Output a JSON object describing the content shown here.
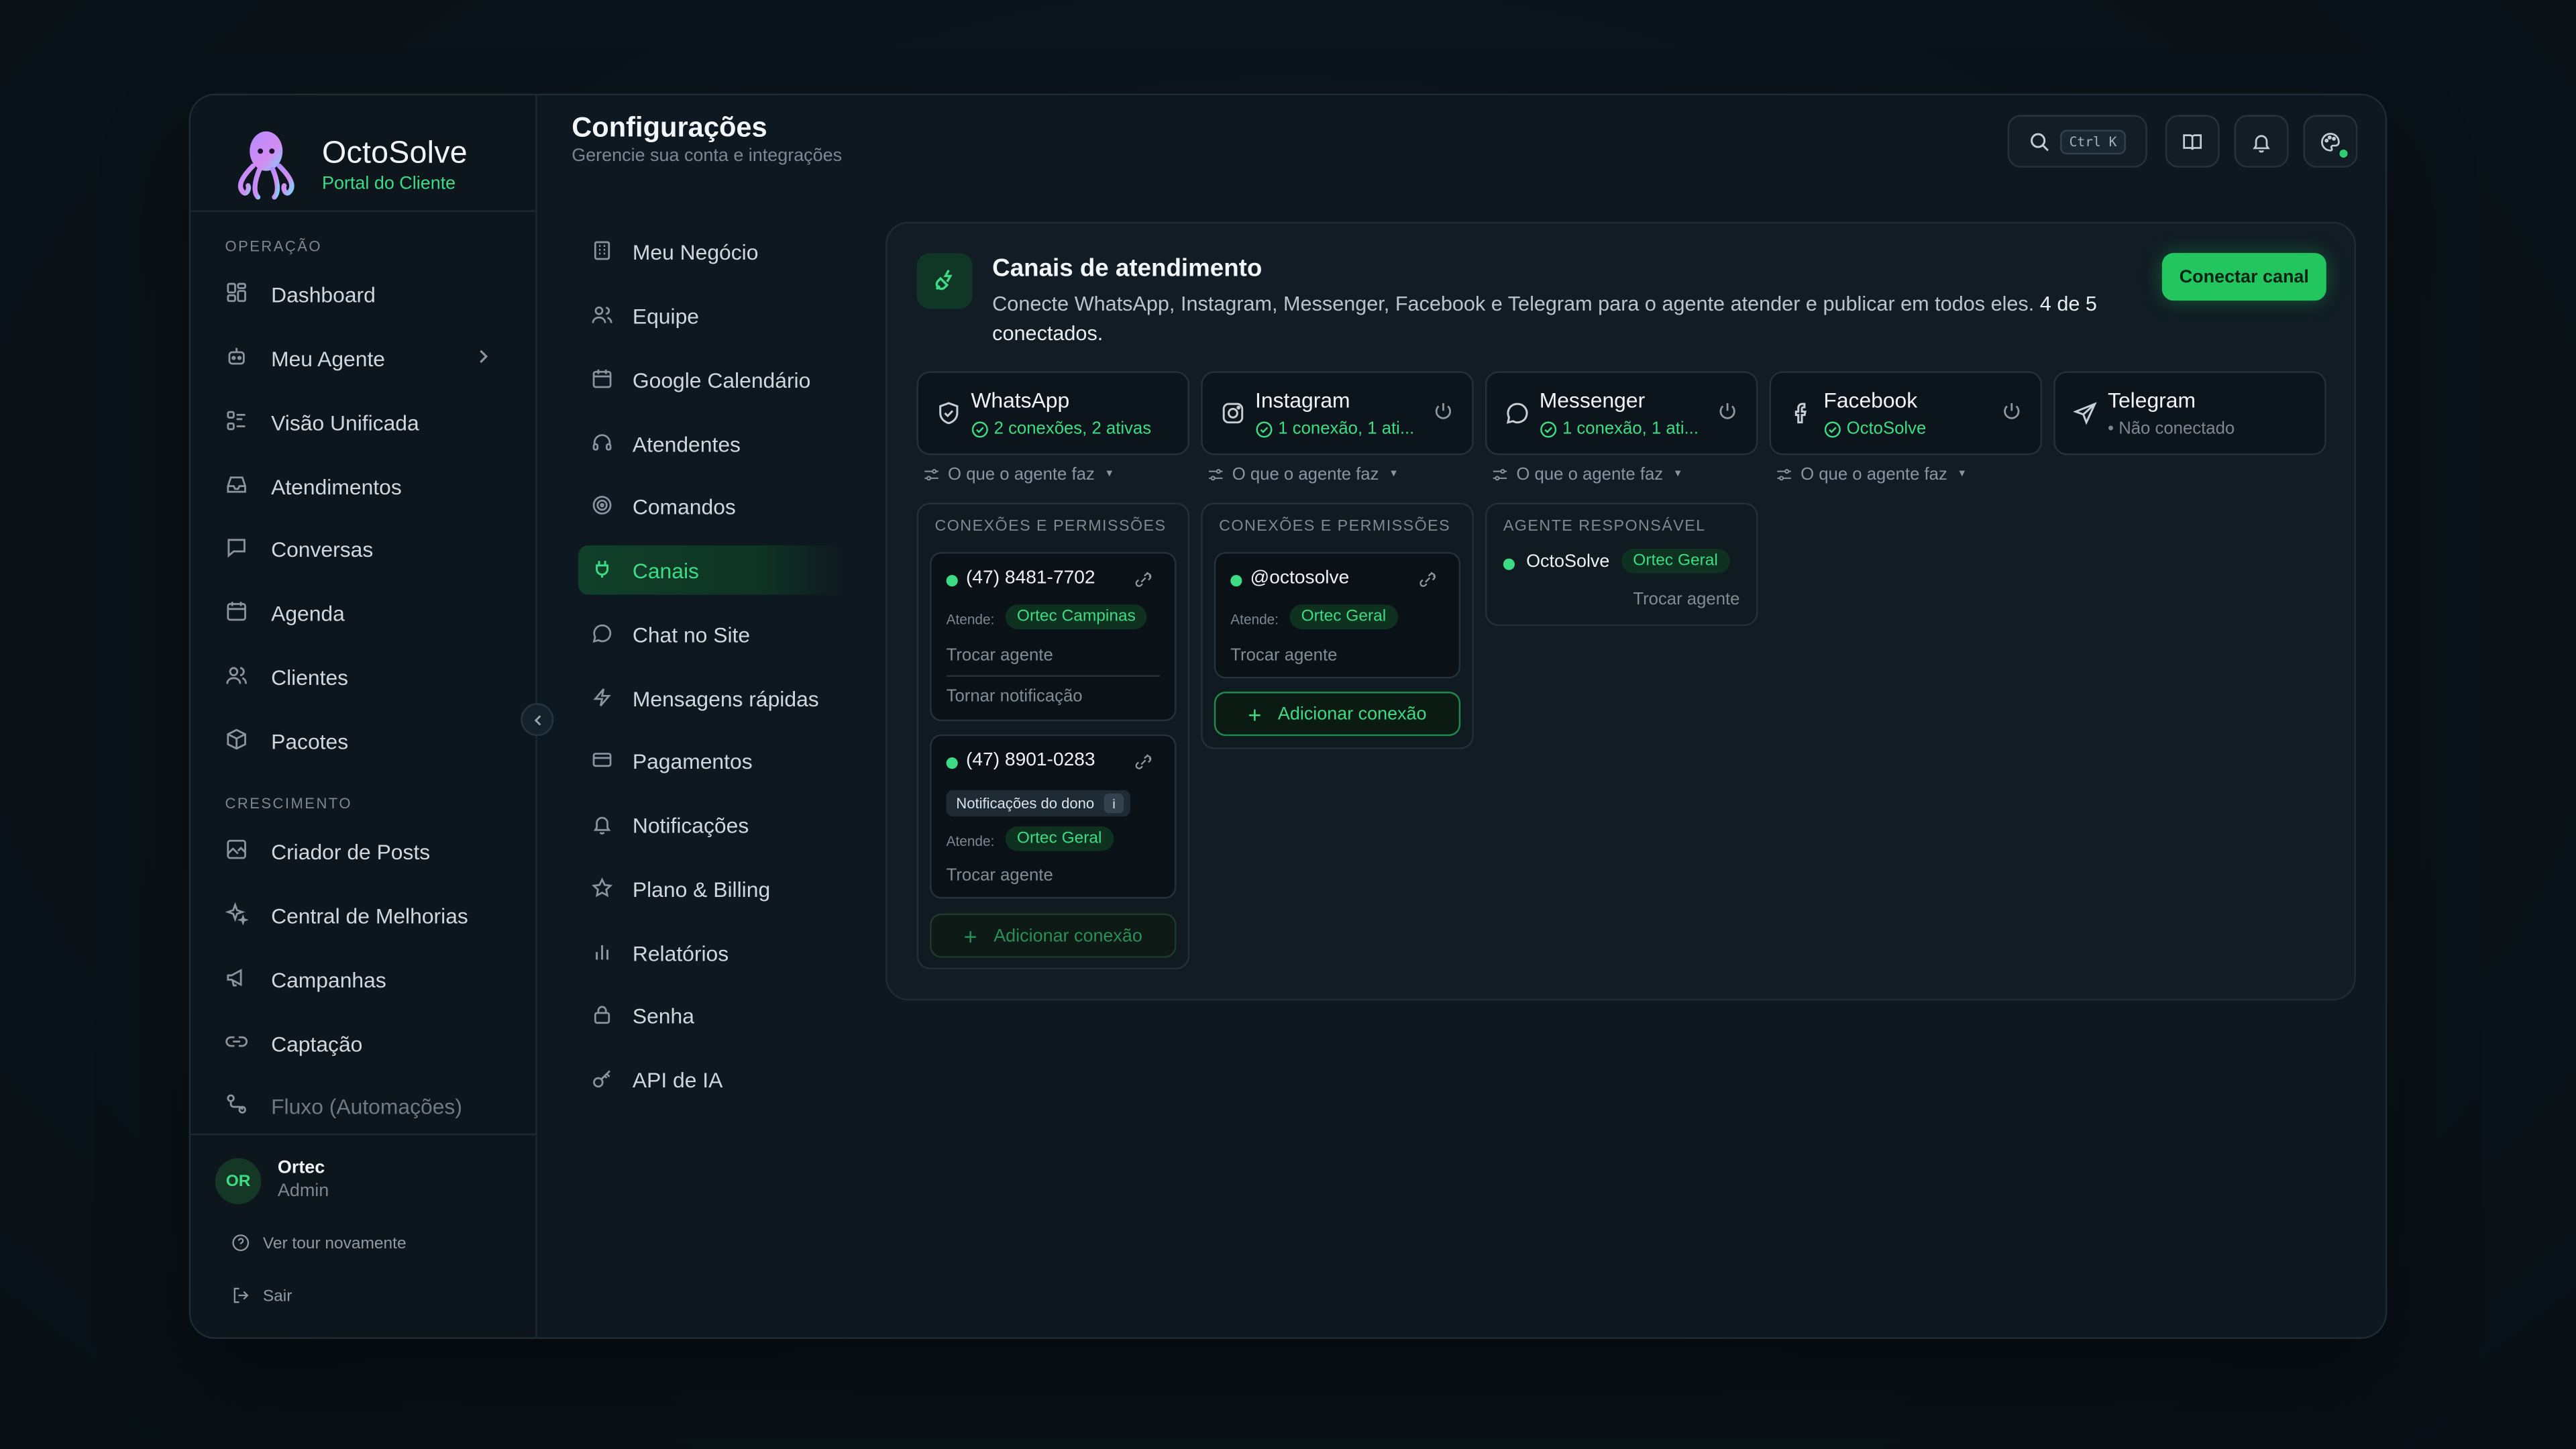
{
  "brand": {
    "name": "OctoSolve",
    "subtitle": "Portal do Cliente"
  },
  "sidebar": {
    "section_operacao": "OPERAÇÃO",
    "section_crescimento": "CRESCIMENTO",
    "items": [
      {
        "label": "Dashboard",
        "icon": "dashboard-icon"
      },
      {
        "label": "Meu Agente",
        "icon": "bot-icon"
      },
      {
        "label": "Visão Unificada",
        "icon": "list-icon"
      },
      {
        "label": "Atendimentos",
        "icon": "inbox-icon"
      },
      {
        "label": "Conversas",
        "icon": "chat-icon"
      },
      {
        "label": "Agenda",
        "icon": "calendar-icon"
      },
      {
        "label": "Clientes",
        "icon": "users-icon"
      },
      {
        "label": "Pacotes",
        "icon": "package-icon"
      },
      {
        "label": "Criador de Posts",
        "icon": "edit-image-icon"
      },
      {
        "label": "Central de Melhorias",
        "icon": "sparkles-icon"
      },
      {
        "label": "Campanhas",
        "icon": "megaphone-icon"
      },
      {
        "label": "Captação",
        "icon": "link-icon"
      },
      {
        "label": "Fluxo (Automações)",
        "icon": "workflow-icon"
      }
    ],
    "user": {
      "initials": "OR",
      "name": "Ortec",
      "role": "Admin"
    },
    "tour_label": "Ver tour novamente",
    "logout_label": "Sair"
  },
  "header": {
    "title": "Configurações",
    "subtitle": "Gerencie sua conta e integrações",
    "search_shortcut": "Ctrl K"
  },
  "settings_nav": [
    {
      "label": "Meu Negócio",
      "icon": "building-icon"
    },
    {
      "label": "Equipe",
      "icon": "users-icon"
    },
    {
      "label": "Google Calendário",
      "icon": "calendar-icon"
    },
    {
      "label": "Atendentes",
      "icon": "headset-icon"
    },
    {
      "label": "Comandos",
      "icon": "target-icon"
    },
    {
      "label": "Canais",
      "icon": "plug-icon",
      "active": true
    },
    {
      "label": "Chat no Site",
      "icon": "chat-icon"
    },
    {
      "label": "Mensagens rápidas",
      "icon": "zap-icon"
    },
    {
      "label": "Pagamentos",
      "icon": "credit-card-icon"
    },
    {
      "label": "Notificações",
      "icon": "bell-icon"
    },
    {
      "label": "Plano & Billing",
      "icon": "star-icon"
    },
    {
      "label": "Relatórios",
      "icon": "bar-chart-icon"
    },
    {
      "label": "Senha",
      "icon": "lock-icon"
    },
    {
      "label": "API de IA",
      "icon": "key-icon"
    }
  ],
  "channels_card": {
    "title": "Canais de atendimento",
    "description": "Conecte WhatsApp, Instagram, Messenger, Facebook e Telegram para o agente atender e publicar em todos eles.",
    "count_text": "4 de 5 conectados.",
    "connect_button": "Conectar canal",
    "agent_do_label": "O que o agente faz",
    "perm_label": "CONEXÕES E PERMISSÕES",
    "agent_resp_label": "AGENTE RESPONSÁVEL",
    "atende_label": "Atende:",
    "trocar_label": "Trocar agente",
    "tornar_notif_label": "Tornar notificação",
    "owner_tag": "Notificações do dono",
    "add_conn_label": "Adicionar conexão",
    "channels": [
      {
        "name": "WhatsApp",
        "status": "2 conexões, 2 ativas",
        "connected": true,
        "icon": "shield-icon"
      },
      {
        "name": "Instagram",
        "status": "1 conexão, 1 ati...",
        "connected": true,
        "icon": "instagram-icon"
      },
      {
        "name": "Messenger",
        "status": "1 conexão, 1 ati...",
        "connected": true,
        "icon": "messenger-icon"
      },
      {
        "name": "Facebook",
        "status": "OctoSolve",
        "connected": true,
        "icon": "facebook-icon"
      },
      {
        "name": "Telegram",
        "status": "• Não conectado",
        "connected": false,
        "icon": "send-icon"
      }
    ],
    "whatsapp_connections": [
      {
        "number": "(47) 8481-7702",
        "agent": "Ortec Campinas"
      },
      {
        "number": "(47) 8901-0283",
        "agent": "Ortec Geral"
      }
    ],
    "instagram_connection": {
      "handle": "@octosolve",
      "agent": "Ortec Geral"
    },
    "facebook_agent": {
      "page": "OctoSolve",
      "agent": "Ortec Geral"
    }
  },
  "colors": {
    "accent": "#22c55e",
    "accent_text": "#3ddc84",
    "background": "#0e1820"
  }
}
